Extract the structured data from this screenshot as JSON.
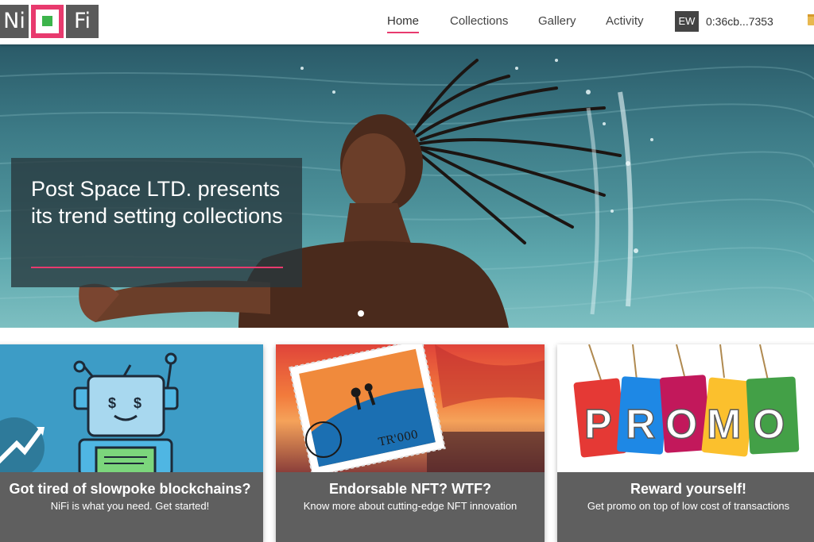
{
  "brand": {
    "left": "Ni",
    "right": "Fi"
  },
  "nav": {
    "home": "Home",
    "collections": "Collections",
    "gallery": "Gallery",
    "activity": "Activity"
  },
  "wallet": {
    "initials": "EW",
    "address": "0:36cb...7353"
  },
  "hero": {
    "title": "Post Space LTD. presents its trend setting collections",
    "active_slide": 1
  },
  "cards": [
    {
      "title": "Got tired of slowpoke blockchains?",
      "subtitle": "NiFi is what you need. Get started!",
      "image": "robot-illustration"
    },
    {
      "title": "Endorsable NFT? WTF?",
      "subtitle": "Know more about cutting-edge NFT innovation",
      "image": "postage-stamp-sunset"
    },
    {
      "title": "Reward yourself!",
      "subtitle": "Get promo on top of low cost of transactions",
      "image": "promo-tags",
      "promo_letters": [
        "P",
        "R",
        "O",
        "M",
        "O"
      ]
    }
  ],
  "colors": {
    "accent": "#e83a6e",
    "logo_green": "#3cb44b",
    "logo_gray": "#5a5a5a",
    "card_footer": "#5f5f5f",
    "promo_tags": [
      "#e53935",
      "#1e88e5",
      "#c2185b",
      "#fbc02d",
      "#43a047"
    ]
  }
}
